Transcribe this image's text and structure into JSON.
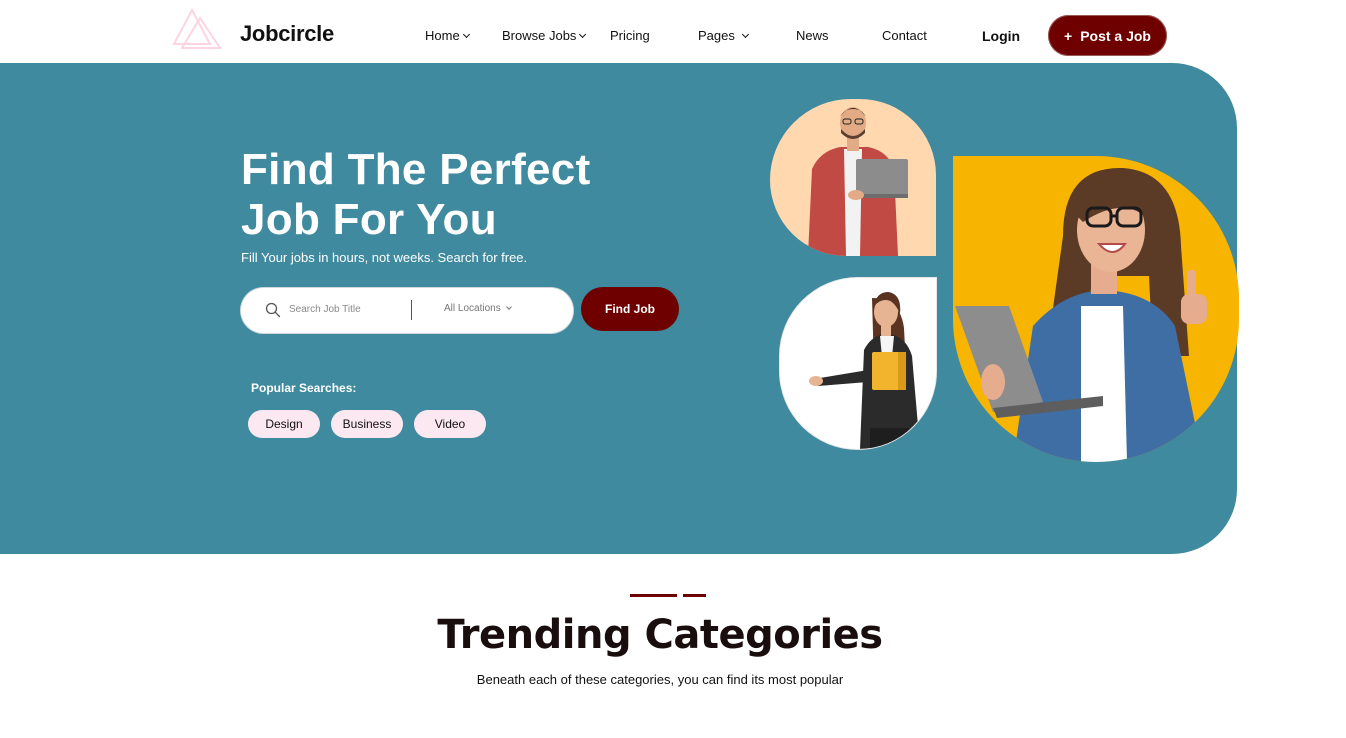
{
  "header": {
    "brand": "Jobcircle",
    "nav": [
      {
        "label": "Home",
        "has_dropdown": true
      },
      {
        "label": "Browse Jobs",
        "has_dropdown": true
      },
      {
        "label": "Pricing",
        "has_dropdown": false
      },
      {
        "label": "Pages",
        "has_dropdown": true
      },
      {
        "label": "News",
        "has_dropdown": false
      },
      {
        "label": "Contact",
        "has_dropdown": false
      }
    ],
    "login_label": "Login",
    "post_job_icon": "+",
    "post_job_label": "Post a Job"
  },
  "hero": {
    "title_line1": "Find The Perfect",
    "title_line2": "Job For You",
    "subtitle": "Fill Your jobs in hours, not weeks. Search for free.",
    "search": {
      "placeholder": "Search Job Title",
      "location_value": "All Locations",
      "button_label": "Find Job"
    },
    "popular_label": "Popular Searches:",
    "popular_tags": [
      "Design",
      "Business",
      "Video"
    ]
  },
  "trending": {
    "title": "Trending Categories",
    "subtitle": "Beneath each of these categories, you can find its most popular"
  },
  "colors": {
    "accent": "#6e0000",
    "hero_bg": "#3f8a9e",
    "tag_bg": "#fce8f0",
    "photo1_bg": "#ffd8b0",
    "photo3_bg": "#f7b400"
  },
  "icons": {
    "logo": "triangle-logo-icon",
    "search": "search-icon",
    "dropdown": "chevron-down-icon"
  }
}
